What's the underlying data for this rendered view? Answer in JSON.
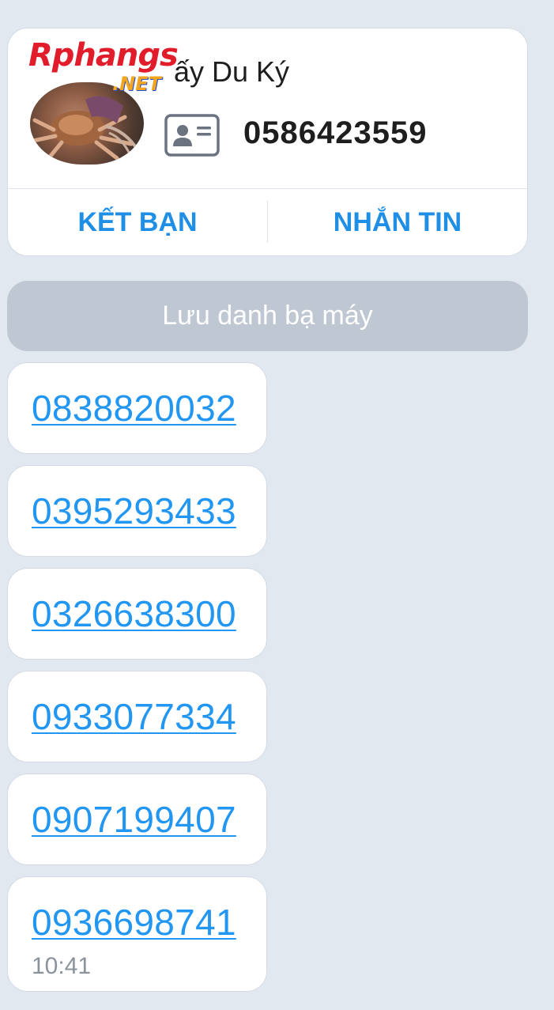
{
  "contact": {
    "name_visible": "ấy Du Ký",
    "phone": "0586423559",
    "watermark_main": "Rphangs",
    "watermark_sub": ".NET",
    "actions": {
      "add_friend": "KẾT BẠN",
      "message": "NHẮN TIN"
    }
  },
  "save_contact_label": "Lưu danh bạ máy",
  "messages": [
    {
      "text": "0838820032"
    },
    {
      "text": "0395293433"
    },
    {
      "text": "0326638300"
    },
    {
      "text": "0933077334"
    },
    {
      "text": "0907199407"
    },
    {
      "text": "0936698741",
      "time": "10:41"
    }
  ],
  "colors": {
    "background": "#e2e8f0",
    "accent": "#1f8fe6",
    "link": "#2196f3",
    "save_bar": "#bfc8d2"
  }
}
